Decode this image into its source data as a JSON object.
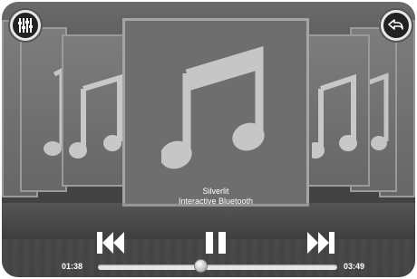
{
  "track": {
    "title": "Silverlit",
    "artist": "Interactive Bluetooth"
  },
  "time": {
    "elapsed": "01:38",
    "total": "03:49",
    "progress": 0.43
  },
  "buttons": {
    "equalizer": "equalizer-icon",
    "back": "back-icon",
    "previous": "previous-icon",
    "pause": "pause-icon",
    "next": "next-icon"
  },
  "colors": {
    "background": "#4a4a4a",
    "card": "#6e6e6e",
    "note": "#c6c6c6",
    "text": "#ffffff"
  }
}
